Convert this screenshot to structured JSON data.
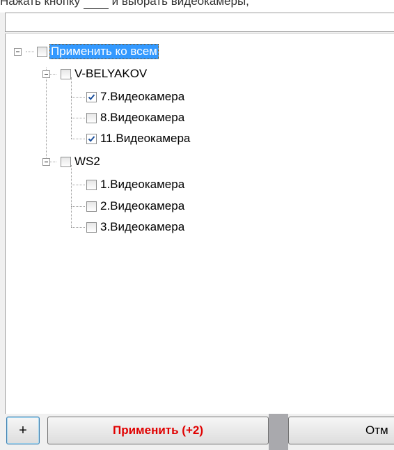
{
  "caption": {
    "before": "Нажать кнопку",
    "after": "и выбрать видеокамеры,"
  },
  "tree": {
    "root": {
      "label": "Применить ко всем",
      "checked": false,
      "expanded": true
    },
    "servers": [
      {
        "label": "V-BELYAKOV",
        "checked": false,
        "expanded": true,
        "cameras": [
          {
            "label": "7.Видеокамера",
            "checked": true
          },
          {
            "label": "8.Видеокамера",
            "checked": false
          },
          {
            "label": "11.Видеокамера",
            "checked": true
          }
        ]
      },
      {
        "label": "WS2",
        "checked": false,
        "expanded": true,
        "cameras": [
          {
            "label": "1.Видеокамера",
            "checked": false
          },
          {
            "label": "2.Видеокамера",
            "checked": false
          },
          {
            "label": "3.Видеокамера",
            "checked": false
          }
        ]
      }
    ]
  },
  "buttons": {
    "add_label": "+",
    "apply_label": "Применить (+2)",
    "cancel_label": "Отм"
  },
  "colors": {
    "selection": "#3399ff",
    "apply_text": "#e00000",
    "check_mark": "#1b4f9c"
  }
}
